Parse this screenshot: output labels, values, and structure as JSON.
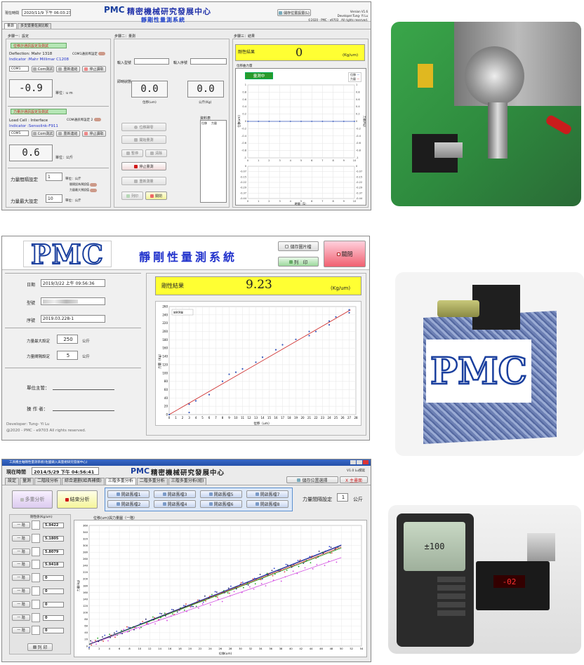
{
  "colors": {
    "pmc_blue": "#1a3f9e",
    "pmc_red": "#d01818",
    "title_blue": "#2233aa",
    "result_yellow": "#ffff33",
    "status_green": "#b5e6b5",
    "close_red": "#f06070",
    "fit_line": "#cc2222",
    "dot_blue": "#3355bb"
  },
  "w1": {
    "time_label": "現在時間",
    "time_value": "2020/11/9 下午 06:03:23",
    "brand": "PMC",
    "center": "精密機械研究發展中心",
    "subtitle": "靜剛性量測系統",
    "version": "Version V1.6",
    "developer": "Developer:Tung- Yi Lu",
    "copyright": "©2020 - PMC - e9703 . All rights reserved.",
    "save_btn": "儲存位置設置(L)",
    "tabs": [
      "量測",
      "多支暨量佐資比較"
    ],
    "step1": "步驟一：設定",
    "step2": "步驟二：量測",
    "step3": "步驟三：結果",
    "disp_title": "位移計通訊設定及測試",
    "deflection": "Deflection: Mahr 1318",
    "indicator1": "Indicator :Mahr  Millimar  C1208",
    "com1_label": "COM1通訊埠設定",
    "com1": "COM1",
    "btn_com": "Com測試",
    "btn_reset": "重新連結",
    "btn_stop": "停止讀取",
    "disp_value": "-0.9",
    "disp_unit": "單位：u m",
    "force_title": "力量計通訊設定及測試",
    "loadcell": "Load Cell : Interface",
    "indicator2": "Indicator :Sensolink-F911",
    "com2_label": "COM通訊埠設定 2",
    "com5": "COM5",
    "force_value": "0.6",
    "force_unit": "單位：公斤",
    "interval_label": "力量間隔設定",
    "interval_value": "1",
    "unit_kg": "單位：公斤",
    "max_label": "力量最大設定",
    "max_value": "10",
    "t_interval": "間隔設為預設值",
    "t_max": "力量最大預設值",
    "model_label": "輸入型號",
    "serial_label": "輸入序號",
    "reading_label": "即時狀態",
    "disp_read": "0.0",
    "disp_read_unit": "位移(um)",
    "force_read": "0.0",
    "force_read_unit": "公斤(Kg)",
    "btn_reset_disp": "位移歸零",
    "btn_start": "開始量測",
    "btn_pause": "暫停",
    "btn_clear": "清除",
    "btn_stop_meas": "停止量測",
    "btn_retest": "重新測量",
    "btn_print": "列印",
    "btn_close": "關閉",
    "data_title": "資料表",
    "col_disp": "位移",
    "col_force": "力量",
    "result_label": "剛性結果",
    "result_value": "0",
    "result_unit": "(Kg/um)",
    "chart_title": "位移曲力量",
    "measuring": "量測中",
    "legend_disp": "位移",
    "legend_force": "力量",
    "xlabel": "時間（S）"
  },
  "w2": {
    "brand": "PMC",
    "title": "靜剛性量測系統",
    "save_btn": "儲存圖片檔",
    "print_btn": "列　印",
    "close_btn": "關閉",
    "date_label": "日期",
    "date_value": "2019/3/22 上午 09:56:36",
    "model_label": "型號",
    "serial_label": "序號",
    "serial_value": "2019.03.228-1",
    "max_label": "力量最大設定",
    "max_value": "250",
    "interval_label": "力量間隔設定",
    "interval_value": "5",
    "unit_kg": "公斤",
    "sup_label": "單位主管：",
    "op_label": "操 作 者：",
    "developer": "Developer: Tung- Yi Lu",
    "copyright": "@2020 - PMC - e9703  All rights reserved.",
    "result_label": "剛性結果",
    "result_value": "9.23",
    "result_unit": "(Kg/um)"
  },
  "w3": {
    "titlebar": "工具機主軸剛性量測系統(佐國鎮入與量規研究發展中心)",
    "time_label": "現在時間",
    "time_value": "2014/5/29 下午 04:56:41",
    "brand": "PMC",
    "center": "精密機械研究發展中心",
    "version": "V1.0 Lu撰寫",
    "save_btn": "儲存位置選擇",
    "close_btn": "X 主畫面",
    "tabs": [
      "設定",
      "量測",
      "二階段分析",
      "綜合還劃(給具補償)",
      "三階多重分析",
      "二階多重分析",
      "三階多重分析(組)"
    ],
    "btn_multi": "多重分析",
    "btn_end": "結束分析",
    "files": [
      "開啟舊檔1",
      "開啟舊檔2",
      "開啟舊檔3",
      "開啟舊檔4",
      "開啟舊檔5",
      "開啟舊檔6",
      "開啟舊檔7",
      "開啟舊檔8"
    ],
    "interval_label": "力量間隔設定",
    "interval_value": "1",
    "interval_unit": "公斤",
    "col_header": "剛性係(Kg/um)",
    "chart_header": "位移(um)與力量圖（一階）",
    "stage": "一 階",
    "values": [
      "5.9422",
      "5.1805",
      "5.8079",
      "5.9418",
      "0",
      "0",
      "0",
      "0",
      "0"
    ],
    "print_btn": "列 印",
    "xlabel": "位移(um)",
    "ylabel": "力量(kg)"
  },
  "chart_data": [
    {
      "type": "line",
      "title": "",
      "xlabel": "",
      "ylabel": "位移(um)",
      "y2label": "力量(Kg)",
      "x": [
        0,
        1,
        2,
        3,
        4,
        5,
        6,
        7,
        8,
        9,
        10
      ],
      "xlim": [
        0,
        10
      ],
      "ylim": [
        -1,
        1
      ],
      "y2lim": [
        -1,
        1
      ],
      "series": [
        {
          "name": "位移",
          "values": [
            0,
            0,
            0,
            0,
            0,
            0,
            0,
            0,
            0,
            0,
            0
          ]
        }
      ],
      "grid": true,
      "legend": "top-right"
    },
    {
      "type": "line",
      "title": "",
      "xlabel": "時間（S）",
      "ylabel": "",
      "x": [
        0,
        1,
        2,
        3,
        4,
        5,
        6,
        7,
        8,
        9,
        10
      ],
      "xlim": [
        0,
        10
      ],
      "ylim": [
        -0.44,
        0
      ],
      "y2lim": [
        -0.44,
        0
      ],
      "series": [
        {
          "name": "力量",
          "values": []
        }
      ],
      "grid": true
    },
    {
      "type": "scatter",
      "title": "",
      "xlabel": "位移（um）",
      "ylabel": "力量（Kg）",
      "xlim": [
        0,
        28
      ],
      "ylim": [
        0,
        260
      ],
      "legend": "top-left",
      "legend_text": "放射測量",
      "points": [
        [
          0,
          0
        ],
        [
          3,
          5
        ],
        [
          3,
          25
        ],
        [
          4,
          33
        ],
        [
          6,
          48
        ],
        [
          8,
          80
        ],
        [
          9,
          97
        ],
        [
          10,
          102
        ],
        [
          11,
          110
        ],
        [
          13,
          126
        ],
        [
          14,
          138
        ],
        [
          16,
          156
        ],
        [
          17,
          168
        ],
        [
          19,
          181
        ],
        [
          21,
          190
        ],
        [
          21,
          200
        ],
        [
          22,
          200
        ],
        [
          24,
          216
        ],
        [
          24,
          225
        ],
        [
          25,
          235
        ],
        [
          27,
          245
        ],
        [
          27,
          252
        ]
      ],
      "fit": [
        [
          0,
          0
        ],
        [
          27.2,
          252
        ]
      ],
      "grid": true
    },
    {
      "type": "scatter",
      "title": "",
      "xlabel": "位移(um)",
      "ylabel": "力量(kg)",
      "xlim": [
        0,
        54
      ],
      "ylim": [
        0,
        360
      ],
      "series": [
        {
          "color": "#2a3fd0",
          "slope": 5.94
        },
        {
          "color": "#e23a3a",
          "slope": 5.81
        },
        {
          "color": "#1aa51a",
          "slope": 5.75
        },
        {
          "color": "#d24be0",
          "slope": 5.18
        },
        {
          "color": "#222266",
          "slope": 5.9
        }
      ],
      "grid": true
    }
  ]
}
